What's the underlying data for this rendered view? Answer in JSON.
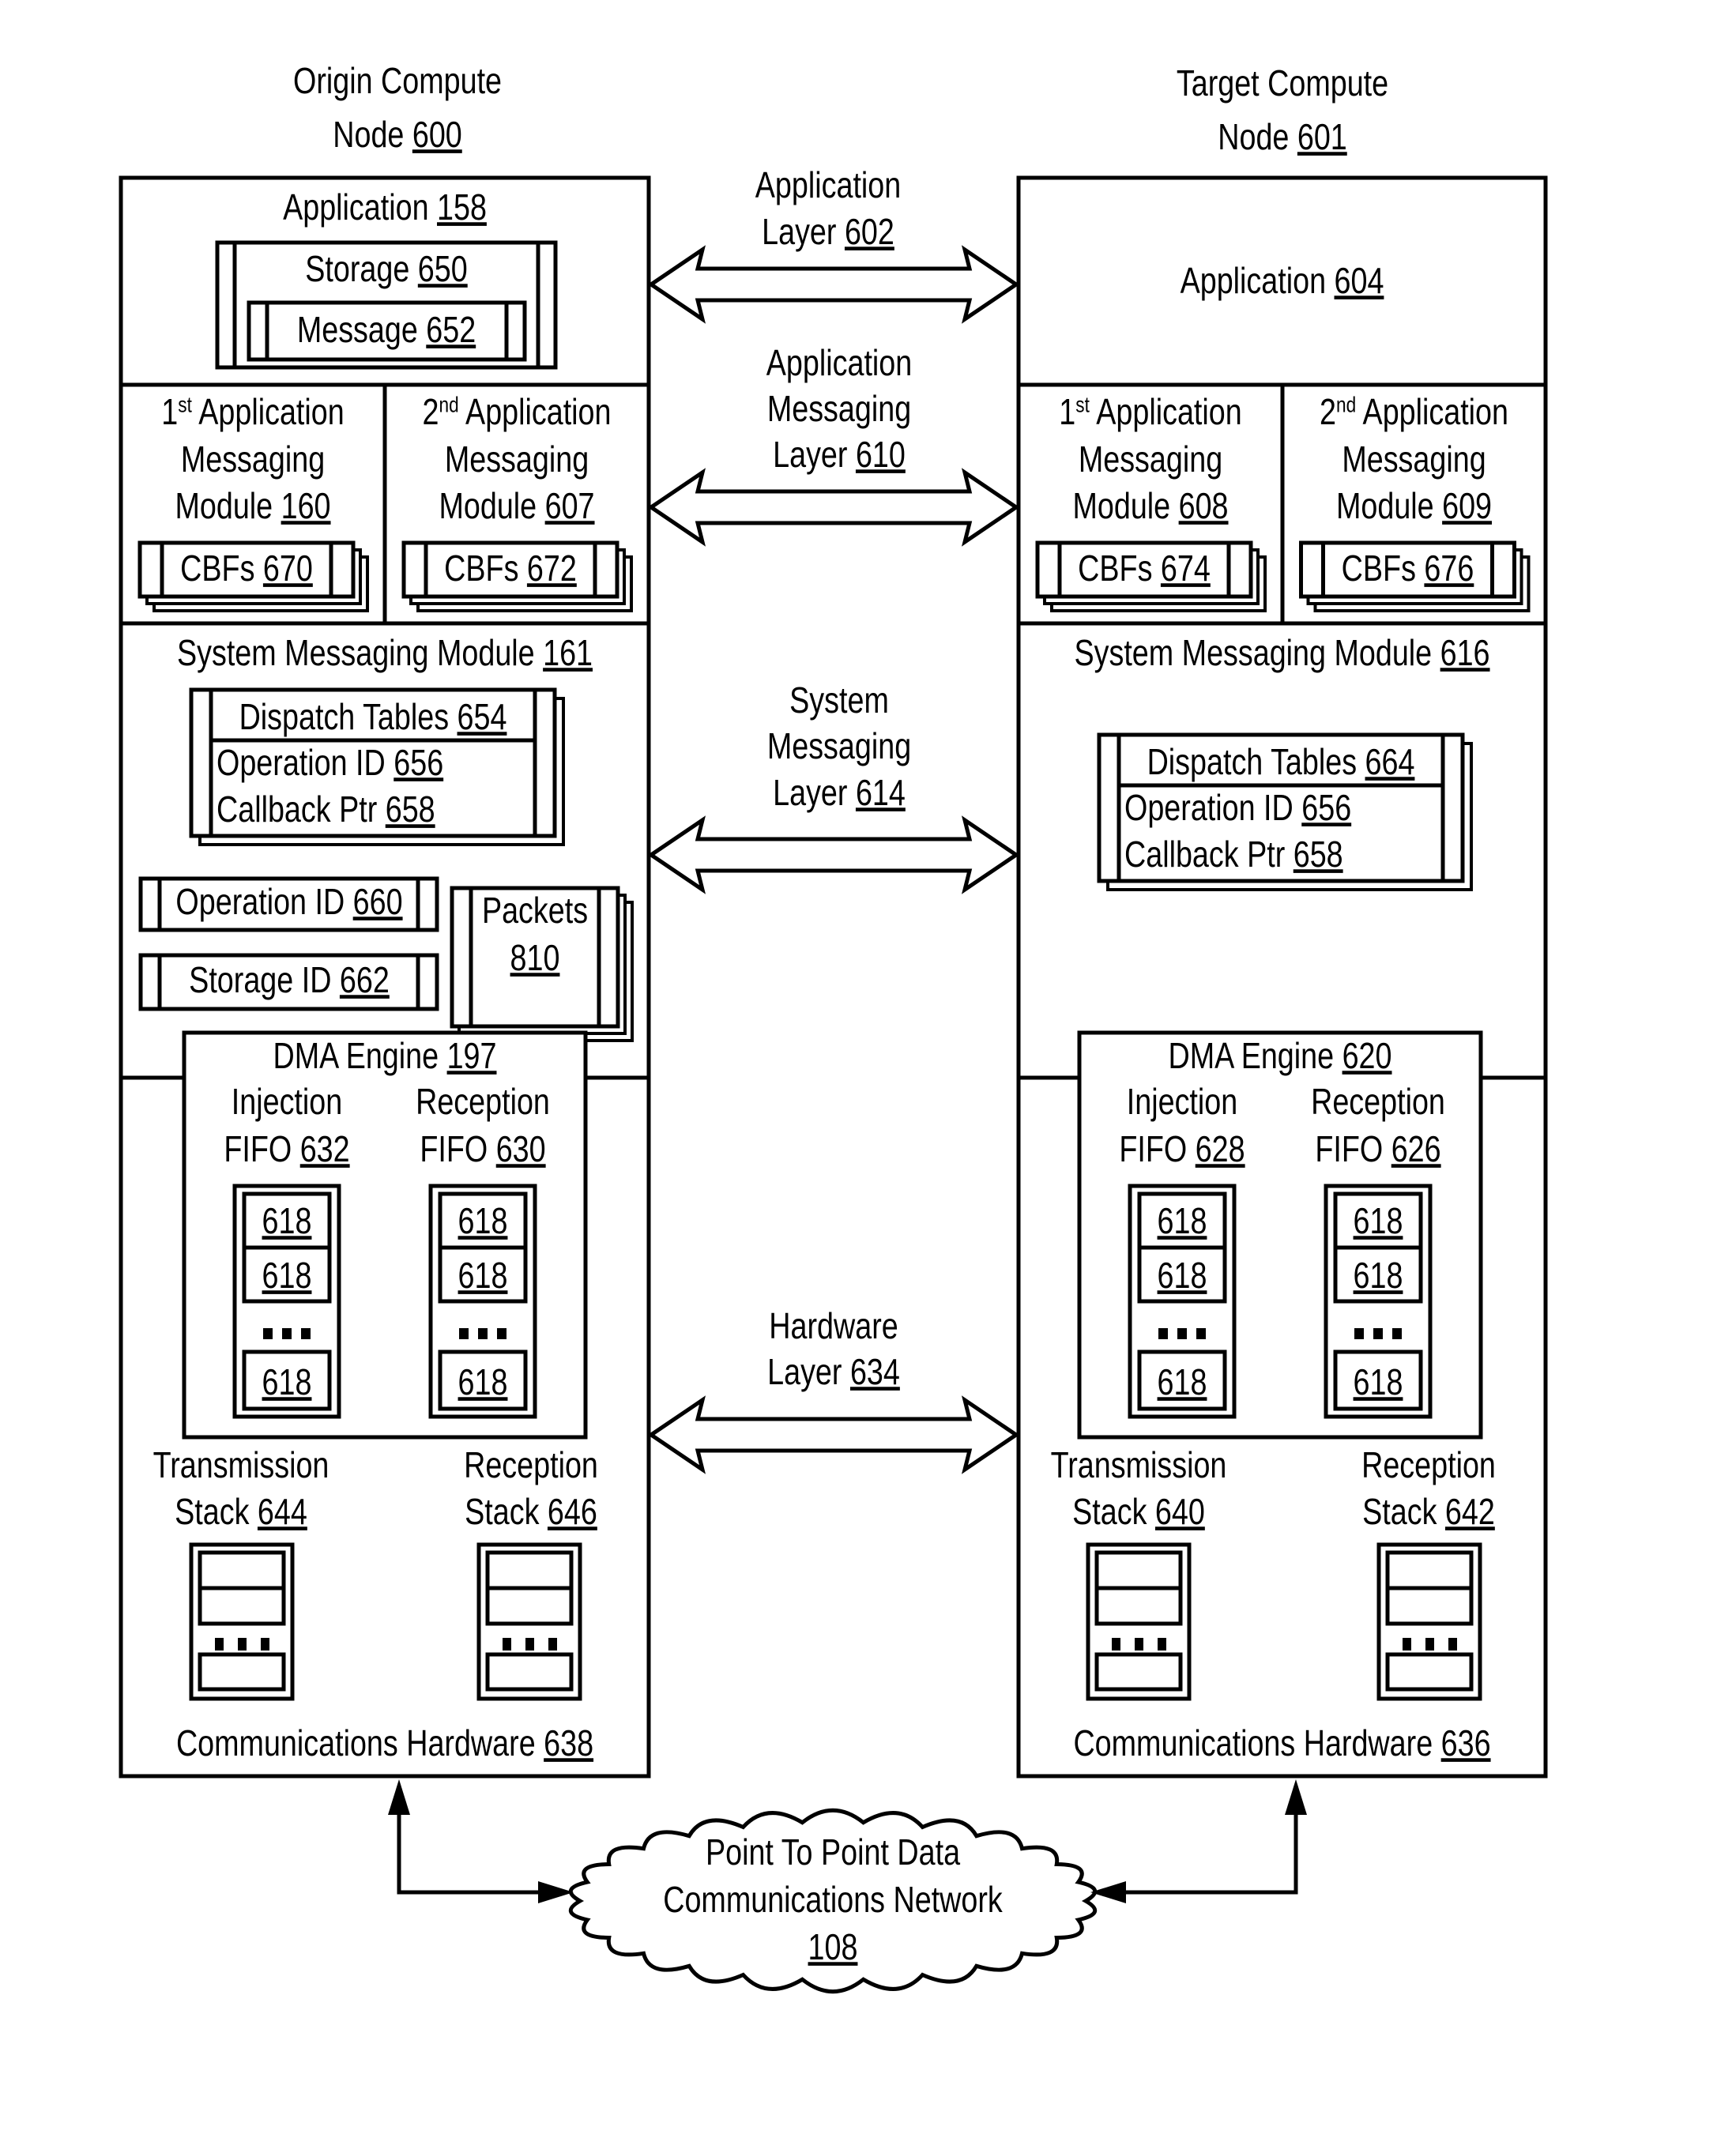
{
  "origin_node": {
    "title_line1": "Origin Compute",
    "title_line2_text": "Node ",
    "title_line2_ref": "600",
    "application": {
      "text": "Application ",
      "ref": "158"
    },
    "storage": {
      "text": "Storage ",
      "ref": "650"
    },
    "message": {
      "text": "Message ",
      "ref": "652"
    },
    "module1": {
      "line1_num": "1",
      "line1_sup": "st",
      "line1_rest": " Application",
      "line2": "Messaging",
      "line3_text": "Module ",
      "line3_ref": "160",
      "cbf_text": "CBFs ",
      "cbf_ref": "670"
    },
    "module2": {
      "line1_num": "2",
      "line1_sup": "nd",
      "line1_rest": " Application",
      "line2": "Messaging",
      "line3_text": "Module ",
      "line3_ref": "607",
      "cbf_text": "CBFs ",
      "cbf_ref": "672"
    },
    "system_module": {
      "text": "System Messaging Module ",
      "ref": "161"
    },
    "dispatch_tables": {
      "text": "Dispatch Tables ",
      "ref": "654"
    },
    "operation_id_row": {
      "text": "Operation ID ",
      "ref": "656"
    },
    "callback_ptr_row": {
      "text": "Callback Ptr ",
      "ref": "658"
    },
    "operation_id": {
      "text": "Operation ID ",
      "ref": "660"
    },
    "storage_id": {
      "text": "Storage ID ",
      "ref": "662"
    },
    "packets": {
      "line1": "Packets",
      "ref": "810"
    },
    "dma_engine": {
      "text": "DMA Engine ",
      "ref": "197"
    },
    "injection_fifo": {
      "line1": "Injection",
      "line2_text": "FIFO ",
      "ref": "632"
    },
    "reception_fifo": {
      "line1": "Reception",
      "line2_text": "FIFO ",
      "ref": "630"
    },
    "fifo_entries": [
      "618",
      "618",
      "618"
    ],
    "transmission_stack": {
      "line1": "Transmission",
      "line2_text": "Stack ",
      "ref": "644"
    },
    "reception_stack": {
      "line1": "Reception",
      "line2_text": "Stack ",
      "ref": "646"
    },
    "comm_hardware": {
      "text": "Communications Hardware ",
      "ref": "638"
    }
  },
  "target_node": {
    "title_line1": "Target Compute",
    "title_line2_text": "Node ",
    "title_line2_ref": "601",
    "application": {
      "text": "Application ",
      "ref": "604"
    },
    "module1": {
      "line1_num": "1",
      "line1_sup": "st",
      "line1_rest": " Application",
      "line2": "Messaging",
      "line3_text": "Module ",
      "line3_ref": "608",
      "cbf_text": "CBFs ",
      "cbf_ref": "674"
    },
    "module2": {
      "line1_num": "2",
      "line1_sup": "nd",
      "line1_rest": " Application",
      "line2": "Messaging",
      "line3_text": "Module ",
      "line3_ref": "609",
      "cbf_text": "CBFs ",
      "cbf_ref": "676"
    },
    "system_module": {
      "text": "System Messaging Module ",
      "ref": "616"
    },
    "dispatch_tables": {
      "text": "Dispatch Tables ",
      "ref": "664"
    },
    "operation_id_row": {
      "text": "Operation ID ",
      "ref": "656"
    },
    "callback_ptr_row": {
      "text": "Callback Ptr ",
      "ref": "658"
    },
    "dma_engine": {
      "text": "DMA Engine ",
      "ref": "620"
    },
    "injection_fifo": {
      "line1": "Injection",
      "line2_text": "FIFO ",
      "ref": "628"
    },
    "reception_fifo": {
      "line1": "Reception",
      "line2_text": "FIFO ",
      "ref": "626"
    },
    "fifo_entries": [
      "618",
      "618",
      "618"
    ],
    "transmission_stack": {
      "line1": "Transmission",
      "line2_text": "Stack ",
      "ref": "640"
    },
    "reception_stack": {
      "line1": "Reception",
      "line2_text": "Stack ",
      "ref": "642"
    },
    "comm_hardware": {
      "text": "Communications Hardware ",
      "ref": "636"
    }
  },
  "layers": [
    {
      "lines": [
        "Application"
      ],
      "last_text": "Layer ",
      "ref": "602"
    },
    {
      "lines": [
        "Application",
        "Messaging"
      ],
      "last_text": "Layer ",
      "ref": "610"
    },
    {
      "lines": [
        "System",
        "Messaging"
      ],
      "last_text": "Layer ",
      "ref": "614"
    },
    {
      "lines": [
        "Hardware"
      ],
      "last_text": "Layer ",
      "ref": "634"
    }
  ],
  "network": {
    "line1": "Point To Point Data",
    "line2": "Communications Network",
    "ref": "108"
  }
}
